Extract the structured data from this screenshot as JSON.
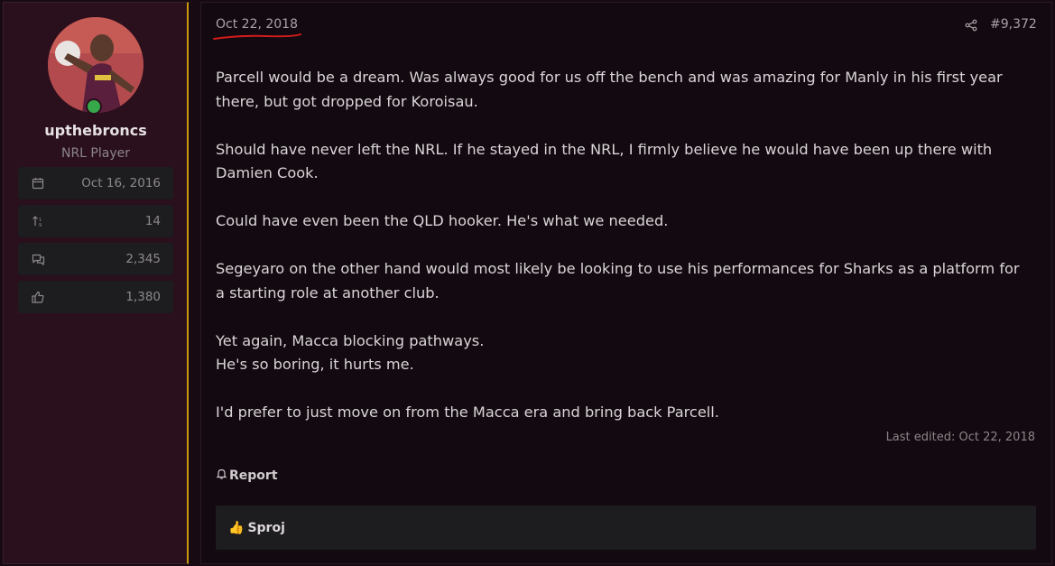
{
  "user": {
    "username": "upthebroncs",
    "title": "NRL Player",
    "stats": [
      {
        "icon": "calendar-icon",
        "value": "Oct 16, 2016"
      },
      {
        "icon": "sort-arrows-icon",
        "value": "14"
      },
      {
        "icon": "messages-icon",
        "value": "2,345"
      },
      {
        "icon": "thumbs-up-icon",
        "value": "1,380"
      }
    ]
  },
  "post": {
    "date": "Oct 22, 2018",
    "number": "#9,372",
    "paragraphs": [
      "Parcell would be a dream. Was always good for us off the bench and was amazing for Manly in his first year there, but got dropped for Koroisau.",
      "Should have never left the NRL. If he stayed in the NRL, I firmly believe he would have been up there with Damien Cook.",
      "Could have even been the QLD hooker. He's what we needed.",
      "Segeyaro on the other hand would most likely be looking to use his performances for Sharks as a platform for a starting role at another club.",
      "Yet again, Macca blocking pathways.",
      "He's so boring, it hurts me.",
      "I'd prefer to just move on from the Macca era and bring back Parcell."
    ],
    "last_edited": "Last edited: Oct 22, 2018",
    "report_label": "Report",
    "reaction": {
      "emoji": "👍",
      "user": "Sproj"
    }
  },
  "colors": {
    "sidebar_bg": "#2a0f1c",
    "accent_border": "#c89a10",
    "post_bg": "#130910",
    "online": "#36a84a",
    "underline": "#d11c1c"
  }
}
